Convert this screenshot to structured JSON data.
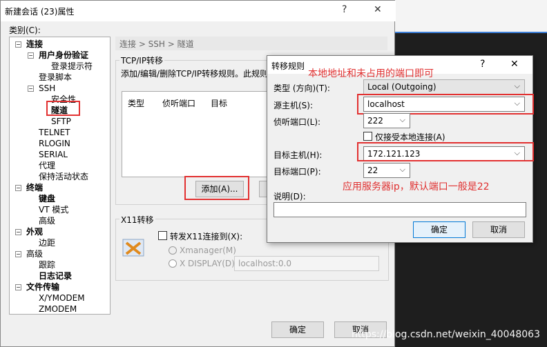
{
  "main_window": {
    "title": "新建会话 (23)属性",
    "help_btn": "?",
    "close_btn": "✕",
    "category_label": "类别(C):",
    "breadcrumb": "连接 > SSH > 隧道",
    "tcp_group": "TCP/IP转移",
    "tcp_desc": "添加/编辑/删除TCP/IP转移规则。此规则",
    "columns": [
      "类型",
      "侦听端口",
      "目标"
    ],
    "add_btn": "添加(A)...",
    "x11_group": "X11转移",
    "x11_forward": "转发X11连接到(X):",
    "xmanager": "Xmanager(M)",
    "xdisplay": "X DISPLAY(D):",
    "xdisplay_value": "localhost:0.0",
    "ok_btn": "确定",
    "cancel_btn": "取消"
  },
  "tree": [
    {
      "label": "连接",
      "bold": true,
      "level": 0,
      "exp": "−"
    },
    {
      "label": "用户身份验证",
      "bold": true,
      "level": 1,
      "exp": "−"
    },
    {
      "label": "登录提示符",
      "bold": false,
      "level": 2
    },
    {
      "label": "登录脚本",
      "bold": false,
      "level": 1
    },
    {
      "label": "SSH",
      "bold": false,
      "level": 1,
      "exp": "−"
    },
    {
      "label": "安全性",
      "bold": false,
      "level": 2
    },
    {
      "label": "隧道",
      "bold": true,
      "level": 2
    },
    {
      "label": "SFTP",
      "bold": false,
      "level": 2
    },
    {
      "label": "TELNET",
      "bold": false,
      "level": 1
    },
    {
      "label": "RLOGIN",
      "bold": false,
      "level": 1
    },
    {
      "label": "SERIAL",
      "bold": false,
      "level": 1
    },
    {
      "label": "代理",
      "bold": false,
      "level": 1
    },
    {
      "label": "保持活动状态",
      "bold": false,
      "level": 1
    },
    {
      "label": "终端",
      "bold": true,
      "level": 0,
      "exp": "−"
    },
    {
      "label": "键盘",
      "bold": true,
      "level": 1
    },
    {
      "label": "VT 模式",
      "bold": false,
      "level": 1
    },
    {
      "label": "高级",
      "bold": false,
      "level": 1
    },
    {
      "label": "外观",
      "bold": true,
      "level": 0,
      "exp": "−"
    },
    {
      "label": "边距",
      "bold": false,
      "level": 1
    },
    {
      "label": "高级",
      "bold": false,
      "level": 0,
      "exp": "−"
    },
    {
      "label": "跟踪",
      "bold": false,
      "level": 1
    },
    {
      "label": "日志记录",
      "bold": true,
      "level": 1
    },
    {
      "label": "文件传输",
      "bold": true,
      "level": 0,
      "exp": "−"
    },
    {
      "label": "X/YMODEM",
      "bold": false,
      "level": 1
    },
    {
      "label": "ZMODEM",
      "bold": false,
      "level": 1
    }
  ],
  "dialog": {
    "title": "转移规则",
    "help_btn": "?",
    "close_btn": "✕",
    "type_label": "类型 (方向)(T):",
    "type_value": "Local (Outgoing)",
    "src_label": "源主机(S):",
    "src_value": "localhost",
    "listen_label": "侦听端口(L):",
    "listen_value": "222",
    "local_only": "仅接受本地连接(A)",
    "dst_label": "目标主机(H):",
    "dst_value": "172.121.123",
    "dst_port_label": "目标端口(P):",
    "dst_port_value": "22",
    "desc_label": "说明(D):",
    "ok_btn": "确定",
    "cancel_btn": "取消"
  },
  "annotations": {
    "note1": "本地地址和未占用的端口即可",
    "note2": "应用服务器ip，默认端口一般是22"
  },
  "watermark": "https://blog.csdn.net/weixin_40048063"
}
